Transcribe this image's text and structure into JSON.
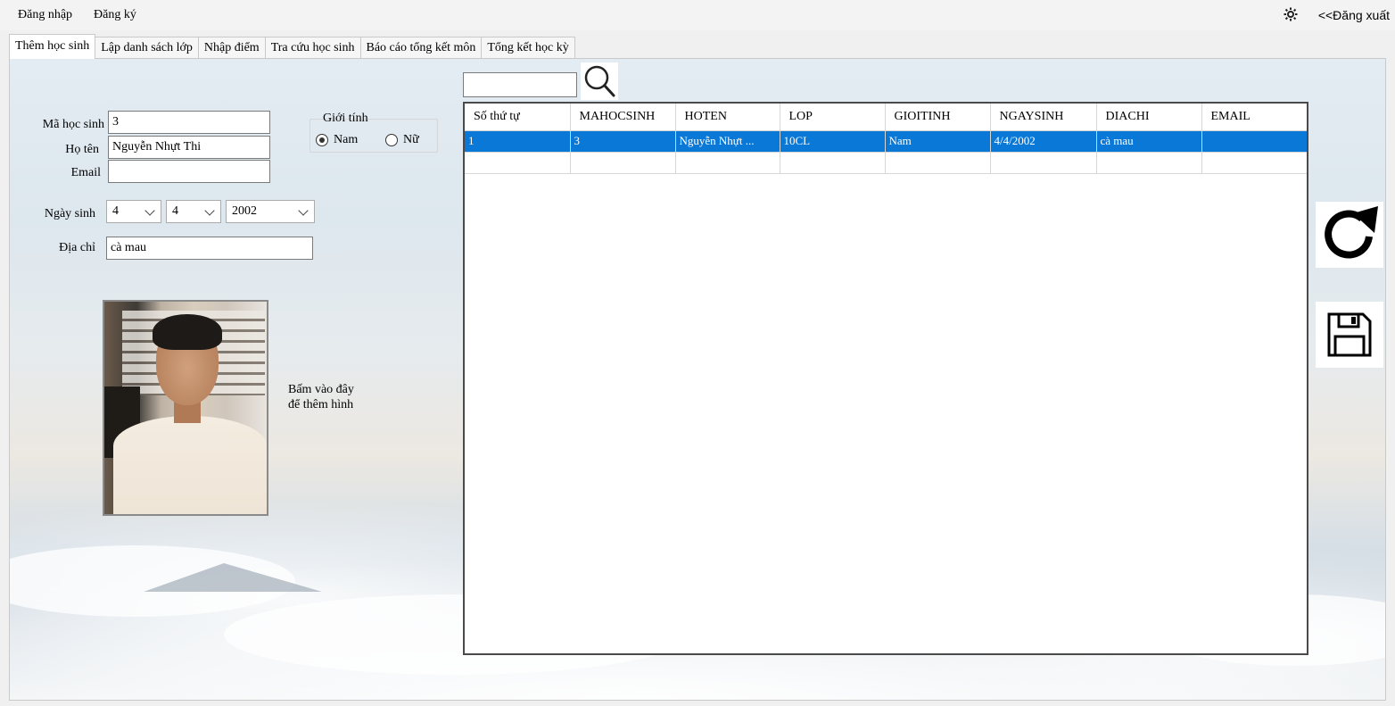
{
  "menubar": {
    "items": [
      "Đăng nhập",
      "Đăng ký"
    ],
    "settings_icon": "gear-icon",
    "logout": "<<Đăng xuất"
  },
  "tabs": [
    {
      "label": "Thêm học sinh",
      "active": true
    },
    {
      "label": "Lập danh sách lớp",
      "active": false
    },
    {
      "label": "Nhập điểm",
      "active": false
    },
    {
      "label": "Tra cứu học sinh",
      "active": false
    },
    {
      "label": "Báo cáo tổng kết môn",
      "active": false
    },
    {
      "label": "Tổng kết học kỳ",
      "active": false
    }
  ],
  "form": {
    "student_id": {
      "label": "Mã học sinh",
      "value": "3"
    },
    "full_name": {
      "label": "Họ tên",
      "value": "Nguyễn Nhựt Thi"
    },
    "email": {
      "label": "Email",
      "value": ""
    },
    "birth_date": {
      "label": "Ngày sinh",
      "day": "4",
      "month": "4",
      "year": "2002"
    },
    "address": {
      "label": "Địa chỉ",
      "value": "cà mau"
    },
    "gender": {
      "title": "Giới tính",
      "options": [
        "Nam",
        "Nữ"
      ],
      "selected": "Nam"
    },
    "photo_caption_line1": "Bấm vào đây",
    "photo_caption_line2": "để thêm hình"
  },
  "search": {
    "value": "",
    "icon": "search-icon"
  },
  "table": {
    "columns": [
      "Số thứ tự",
      "MAHOCSINH",
      "HOTEN",
      "LOP",
      "GIOITINH",
      "NGAYSINH",
      "DIACHI",
      "EMAIL"
    ],
    "rows": [
      [
        "1",
        "3",
        "Nguyễn Nhựt ...",
        "10CL",
        "Nam",
        "4/4/2002",
        "cà mau",
        ""
      ],
      [
        "",
        "",
        "",
        "",
        "",
        "",
        "",
        ""
      ]
    ],
    "selected_row": 0,
    "selection_color": "#0a78d7"
  },
  "side_buttons": {
    "refresh_icon": "refresh-icon",
    "save_icon": "save-icon"
  }
}
